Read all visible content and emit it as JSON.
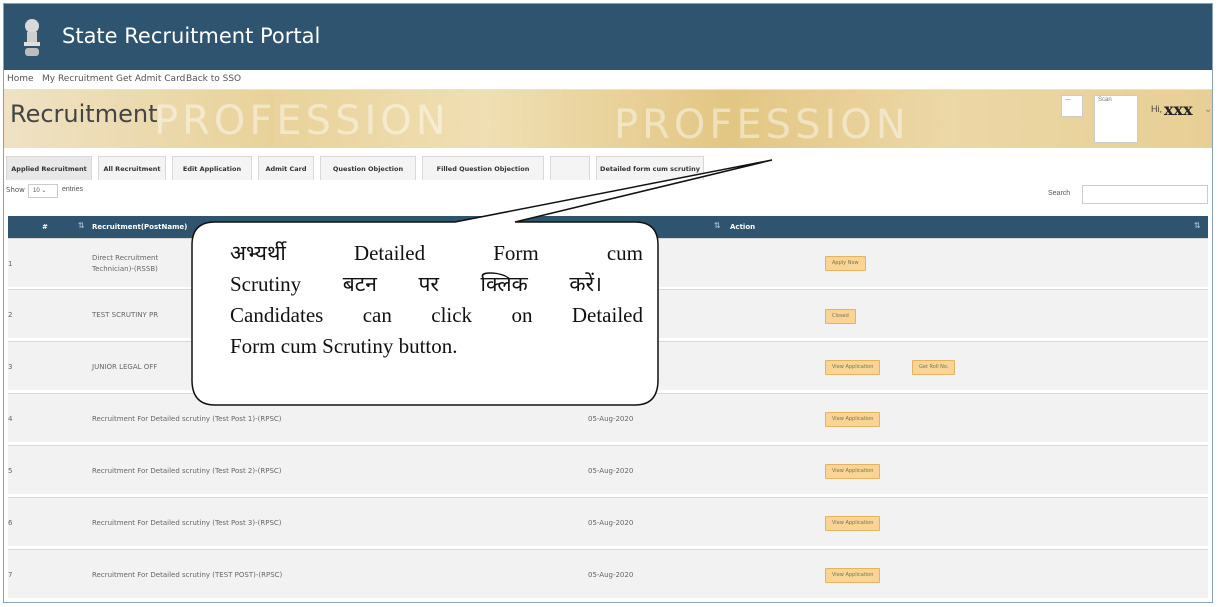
{
  "header": {
    "title": "State Recruitment Portal",
    "emblem_icon": "state-emblem-icon"
  },
  "nav": [
    "Home",
    "My Recruitment",
    "Get Admit Card",
    "Back to SSO"
  ],
  "banner": {
    "page_title": "Recruitment",
    "watermark": "PROFESSION",
    "greeting": "Hi,",
    "user": "xxx",
    "caret": "⌄",
    "mini_box_label": "Scan"
  },
  "tabs": [
    "Applied Recruitment",
    "All Recruitment",
    "Edit Application",
    "Admit Card",
    "Question Objection",
    "Filled Question Objection",
    "",
    "Detailed form cum scrutiny"
  ],
  "table_controls": {
    "show": "Show",
    "entries_value": "10",
    "entries": "entries",
    "search": "Search"
  },
  "table": {
    "columns": [
      "#",
      "Recruitment(PostName)",
      "Action"
    ],
    "rows": [
      {
        "num": "1",
        "post_line1": "Direct Recruitment",
        "post_line2": "Technician)-(RSSB)",
        "date": "",
        "actions": [
          "Apply Now"
        ]
      },
      {
        "num": "2",
        "post_line1": "TEST SCRUTINY PR",
        "post_line2": "",
        "date": "",
        "actions": [
          "Closed"
        ]
      },
      {
        "num": "3",
        "post_line1": "JUNIOR LEGAL OFF",
        "post_line2": "",
        "date": "",
        "actions": [
          "View Application",
          "Get Roll No."
        ]
      },
      {
        "num": "4",
        "post_line1": "Recruitment For Detailed scrutiny (Test Post 1)-(RPSC)",
        "post_line2": "",
        "date": "05-Aug-2020",
        "actions": [
          "View Application"
        ]
      },
      {
        "num": "5",
        "post_line1": "Recruitment For Detailed scrutiny (Test Post 2)-(RPSC)",
        "post_line2": "",
        "date": "05-Aug-2020",
        "actions": [
          "View Application"
        ]
      },
      {
        "num": "6",
        "post_line1": "Recruitment For Detailed scrutiny (Test Post 3)-(RPSC)",
        "post_line2": "",
        "date": "05-Aug-2020",
        "actions": [
          "View Application"
        ]
      },
      {
        "num": "7",
        "post_line1": "Recruitment For Detailed scrutiny (TEST POST)-(RPSC)",
        "post_line2": "",
        "date": "05-Aug-2020",
        "actions": [
          "View Application"
        ]
      }
    ]
  },
  "callout": {
    "line1": [
      "अभ्यर्थी",
      "Detailed",
      "Form",
      "cum"
    ],
    "line2": [
      "Scrutiny",
      "बटन",
      "पर",
      "क्लिक",
      "करें।"
    ],
    "line3": [
      "Candidates",
      "can",
      "click",
      "on",
      "Detailed"
    ],
    "line4": "Form cum Scrutiny button."
  },
  "colors": {
    "header_bg": "#2e5470",
    "button_bg": "#f9d494",
    "row_bg": "#f2f2f2"
  }
}
